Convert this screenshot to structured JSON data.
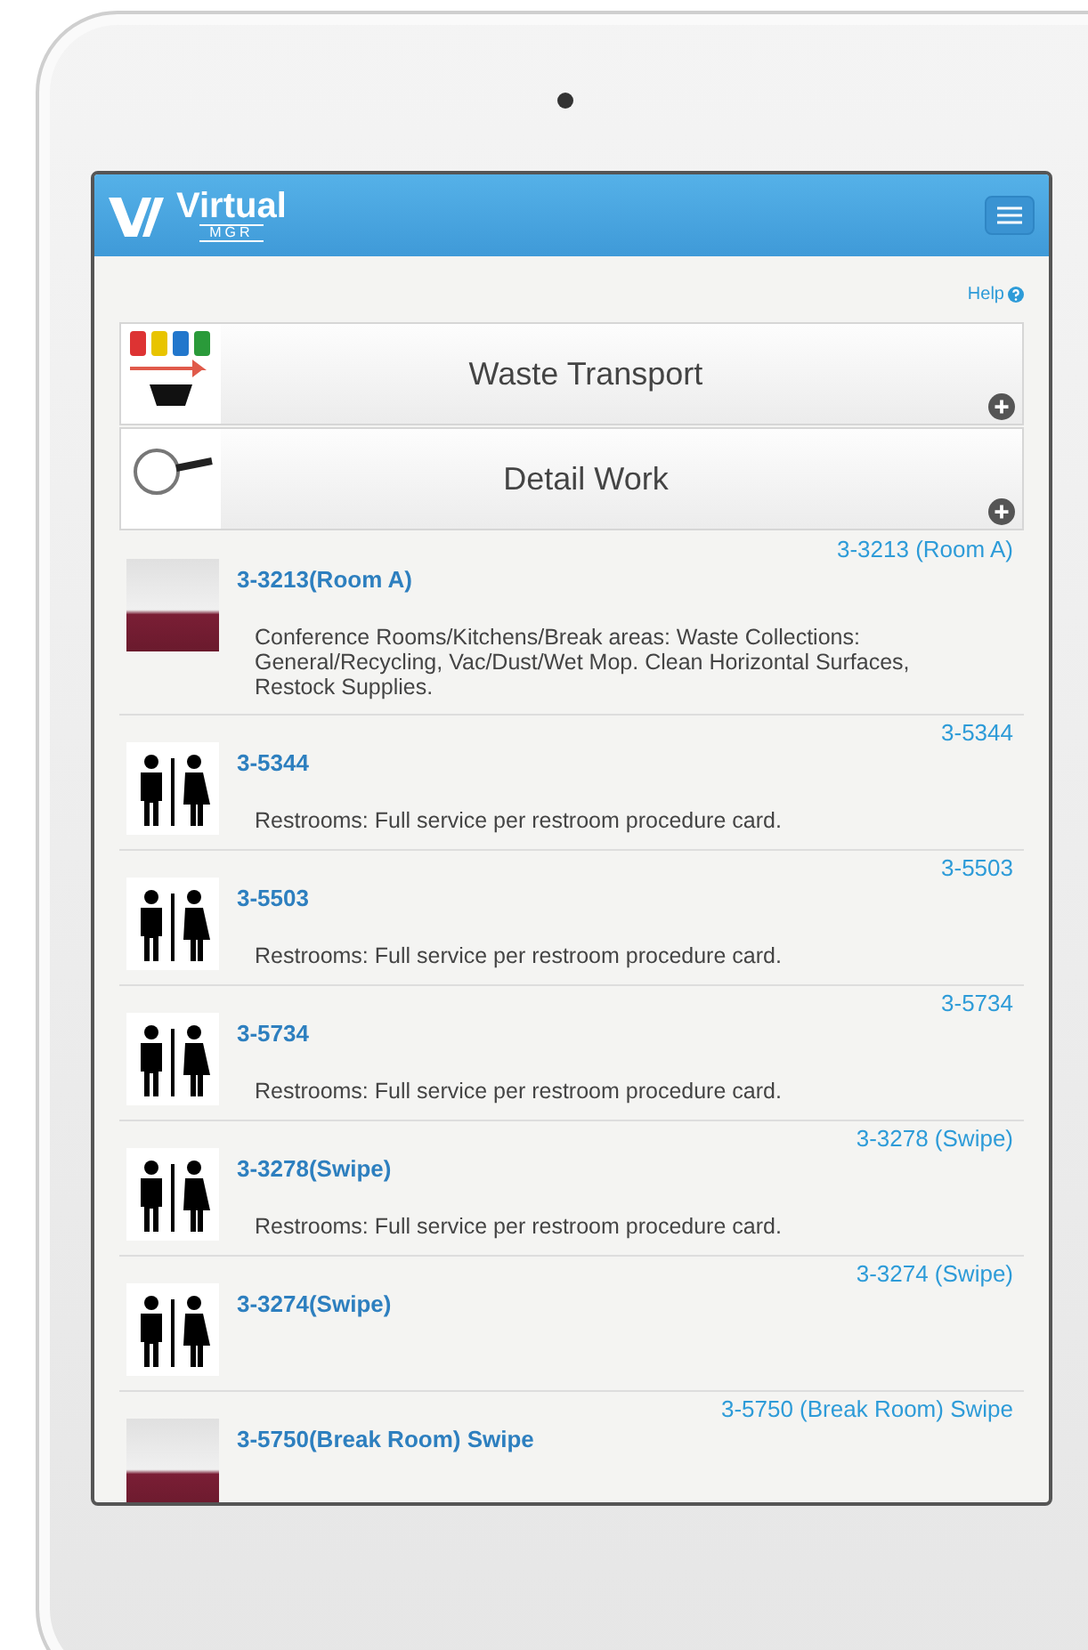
{
  "header": {
    "logo_text": "Virtual",
    "logo_subtext": "MGR"
  },
  "help_link": "Help",
  "categories": [
    {
      "label": "Waste Transport",
      "kind": "waste"
    },
    {
      "label": "Detail Work",
      "kind": "detail"
    }
  ],
  "rooms": [
    {
      "title": "3-3213(Room A)",
      "code": "3-3213 (Room A)",
      "kind": "photo",
      "description": "Conference Rooms/Kitchens/Break areas: Waste Collections: General/Recycling, Vac/Dust/Wet Mop. Clean Horizontal Surfaces, Restock Supplies."
    },
    {
      "title": "3-5344",
      "code": "3-5344",
      "kind": "restroom",
      "description": "Restrooms: Full service per restroom procedure card."
    },
    {
      "title": "3-5503",
      "code": "3-5503",
      "kind": "restroom",
      "description": "Restrooms: Full service per restroom procedure card."
    },
    {
      "title": "3-5734",
      "code": "3-5734",
      "kind": "restroom",
      "description": "Restrooms: Full service per restroom procedure card."
    },
    {
      "title": "3-3278(Swipe)",
      "code": "3-3278 (Swipe)",
      "kind": "restroom",
      "description": "Restrooms: Full service per restroom procedure card."
    },
    {
      "title": "3-3274(Swipe)",
      "code": "3-3274 (Swipe)",
      "kind": "restroom"
    },
    {
      "title": "3-5750(Break Room) Swipe",
      "code": "3-5750 (Break Room) Swipe",
      "kind": "photo"
    }
  ]
}
